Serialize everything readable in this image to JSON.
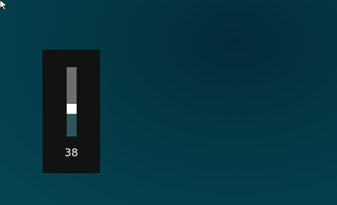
{
  "desktop": {
    "background_color": "#043845"
  },
  "cursor": {
    "icon": "arrow-pointer-icon"
  },
  "volume_flyout": {
    "level": 38,
    "level_fraction": 0.38,
    "value_label": "38",
    "colors": {
      "panel": "#111212",
      "track_upper": "#6e6e6e",
      "track_fill": "#2f565c",
      "thumb": "#ffffff"
    }
  }
}
